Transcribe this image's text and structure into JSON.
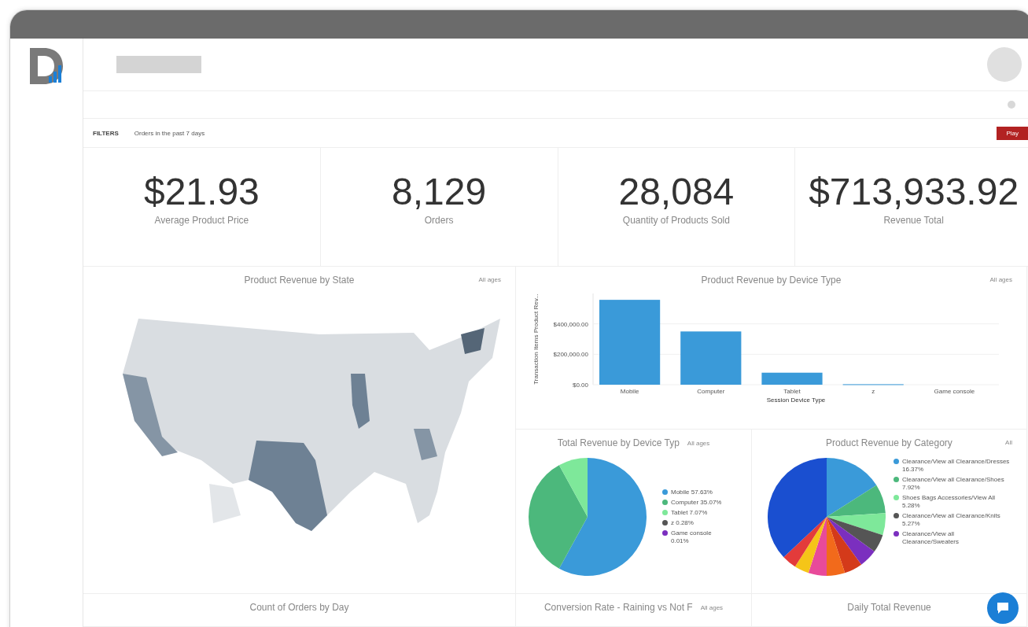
{
  "filters": {
    "label": "FILTERS",
    "description": "Orders in the past 7 days",
    "button": "Play"
  },
  "kpis": [
    {
      "value": "$21.93",
      "label": "Average Product Price"
    },
    {
      "value": "8,129",
      "label": "Orders"
    },
    {
      "value": "28,084",
      "label": "Quantity of Products Sold"
    },
    {
      "value": "$713,933.92",
      "label": "Revenue Total"
    }
  ],
  "map_panel": {
    "title": "Product Revenue by State",
    "tag": "All ages"
  },
  "bar_panel": {
    "title": "Product Revenue by Device Type",
    "tag": "All ages",
    "chart_data": {
      "type": "bar",
      "xlabel": "Session Device Type",
      "ylabel": "Transaction Items Product Rev...",
      "categories": [
        "Mobile",
        "Computer",
        "Tablet",
        "z",
        "Game console"
      ],
      "series": [
        {
          "color": "#3a9ad9",
          "values": [
            558000,
            350000,
            79000,
            3000,
            0
          ]
        }
      ],
      "ylim": [
        0,
        600000
      ],
      "yticks": [
        {
          "value": 0,
          "label": "$0.00"
        },
        {
          "value": 200000,
          "label": "$200,000.00"
        },
        {
          "value": 400000,
          "label": "$400,000.00"
        }
      ]
    }
  },
  "device_pie": {
    "title": "Total Revenue by Device Typ",
    "tag": "All ages",
    "legend": [
      {
        "label": "Mobile 57.63%",
        "color": "#3a9ad9"
      },
      {
        "label": "Computer 35.07%",
        "color": "#4cb87c"
      },
      {
        "label": "Tablet 7.07%",
        "color": "#7ee89a"
      },
      {
        "label": "z 0.28%",
        "color": "#555555"
      },
      {
        "label": "Game console 0.01%",
        "color": "#7b2fbf"
      }
    ]
  },
  "category_pie": {
    "title": "Product Revenue by Category",
    "tag": "All",
    "legend": [
      {
        "label": "Clearance/View all Clearance/Dresses 16.37%",
        "color": "#3a9ad9"
      },
      {
        "label": "Clearance/View all Clearance/Shoes 7.92%",
        "color": "#4cb87c"
      },
      {
        "label": "Shoes Bags Accessories/View All 5.28%",
        "color": "#7ee89a"
      },
      {
        "label": "Clearance/View all Clearance/Knits 5.27%",
        "color": "#555555"
      },
      {
        "label": "Clearance/View all Clearance/Sweaters",
        "color": "#7b2fbf"
      }
    ]
  },
  "bottom_panels": [
    {
      "title": "Count of Orders by Day"
    },
    {
      "title": "Conversion Rate - Raining vs Not F",
      "tag": "All ages"
    },
    {
      "title": "Daily Total Revenue"
    }
  ]
}
